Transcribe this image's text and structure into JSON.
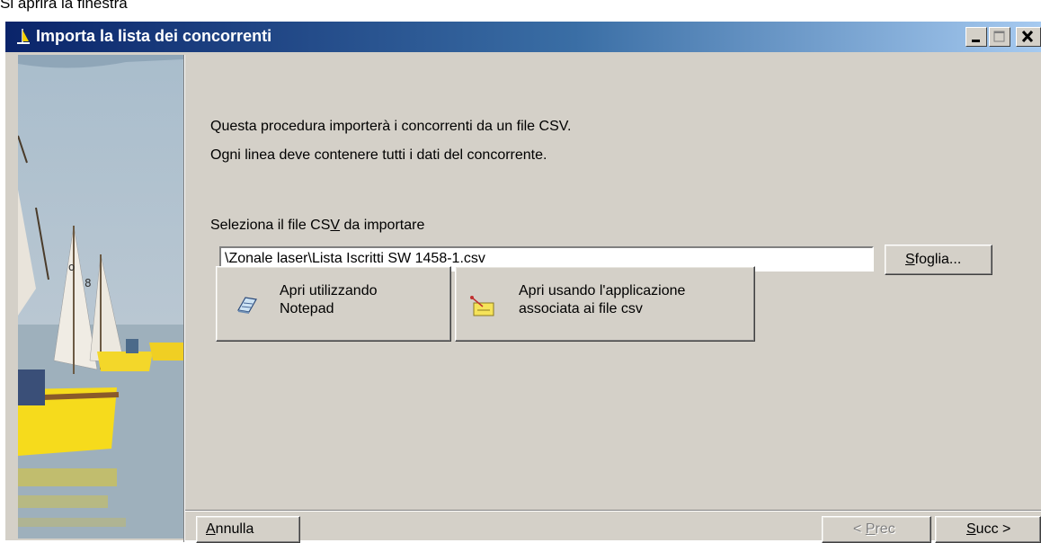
{
  "caption": "Si aprirà la finestra",
  "window": {
    "title": "Importa la lista dei concorrenti"
  },
  "intro": {
    "line1": "Questa procedura importerà i concorrenti da un file CSV.",
    "line2": "Ogni linea deve contenere tutti i dati del concorrente."
  },
  "file_section": {
    "label_before": "Seleziona il file CS",
    "label_accel": "V",
    "label_after": " da importare",
    "path_value": "\\Zonale laser\\Lista Iscritti SW 1458-1.csv",
    "browse_accel": "S",
    "browse_rest": "foglia..."
  },
  "open_buttons": {
    "notepad_line1": "Apri utilizzando",
    "notepad_line2": "Notepad",
    "notepad_icon": "notepad-icon",
    "assoc_line1": "Apri usando l'applicazione",
    "assoc_line2": "associata ai file csv",
    "assoc_icon": "application-icon"
  },
  "footer": {
    "cancel_accel": "A",
    "cancel_rest": "nnulla",
    "prev_prefix": "< ",
    "prev_accel": "P",
    "prev_rest": "rec",
    "next_accel": "S",
    "next_rest": "ucc >"
  }
}
